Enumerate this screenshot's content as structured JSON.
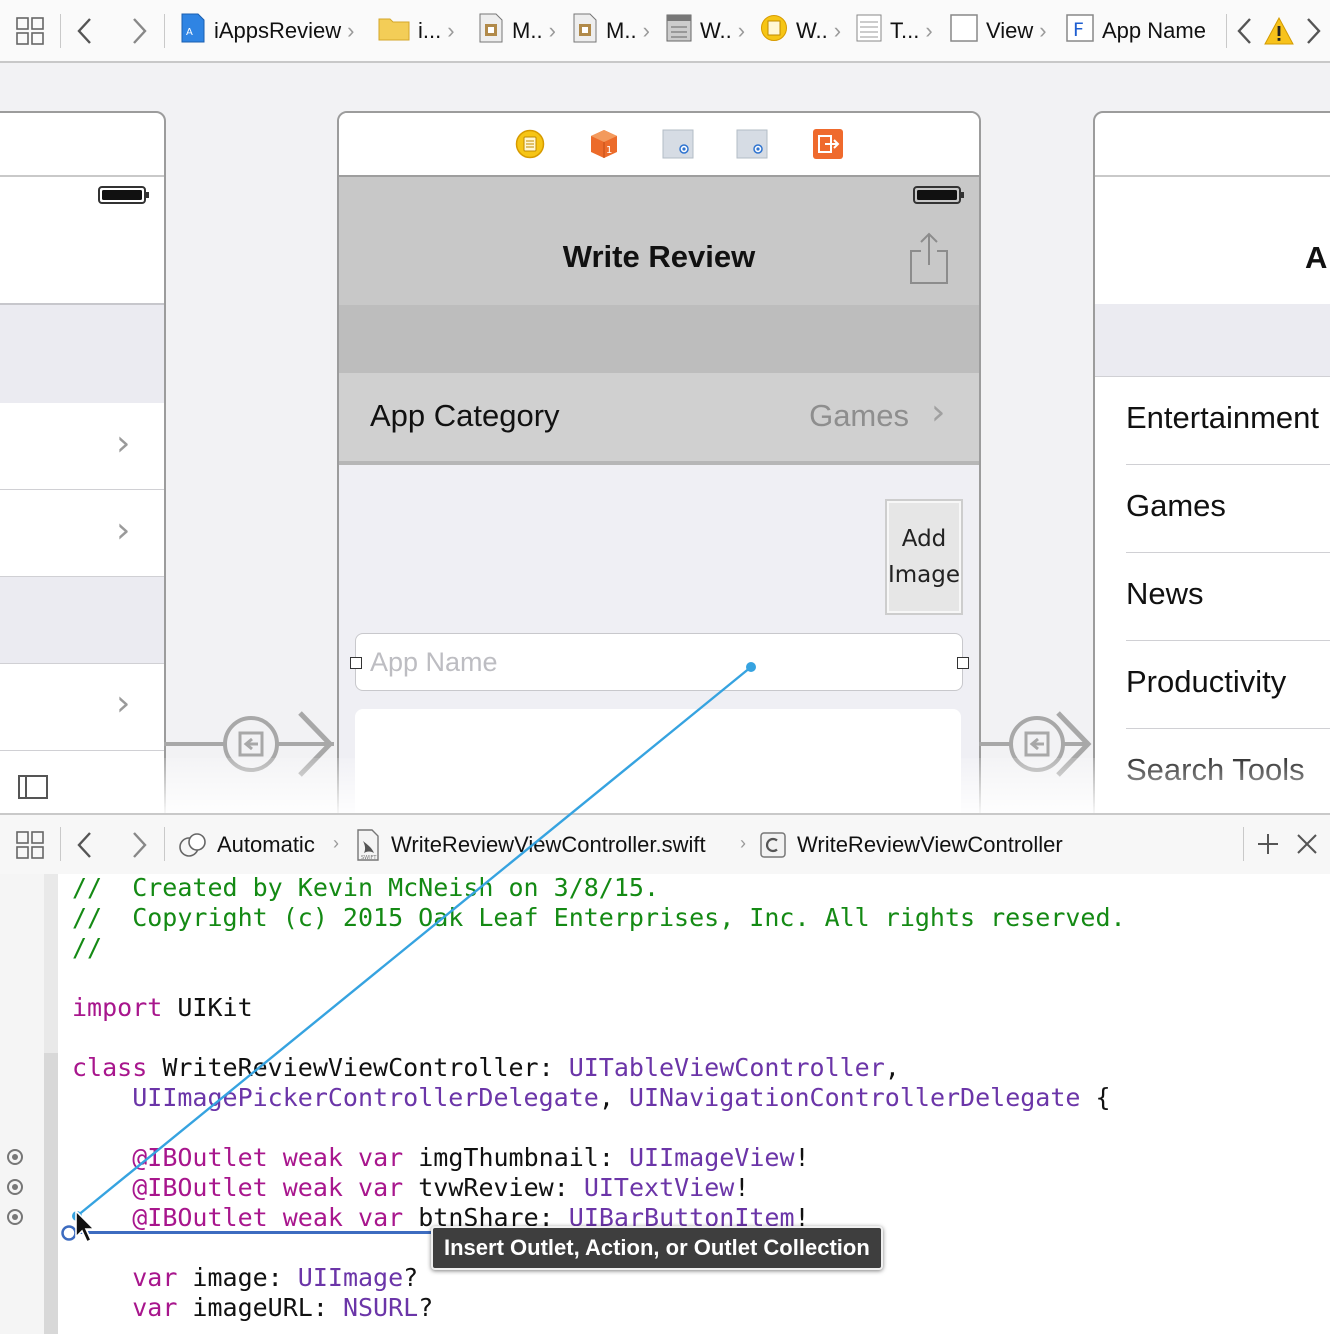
{
  "jump_bar": {
    "breadcrumbs": [
      {
        "label": "iAppsReview",
        "icon": "xcode-project-icon"
      },
      {
        "label": "i...",
        "icon": "folder-icon"
      },
      {
        "label": "M..",
        "icon": "storyboard-file-icon"
      },
      {
        "label": "M..",
        "icon": "storyboard-file-icon"
      },
      {
        "label": "W..",
        "icon": "scene-icon"
      },
      {
        "label": "W..",
        "icon": "view-controller-icon"
      },
      {
        "label": "T...",
        "icon": "table-view-icon"
      },
      {
        "label": "View",
        "icon": "view-icon"
      },
      {
        "label": "App Name",
        "icon": "text-field-icon",
        "icon_glyph": "F"
      }
    ]
  },
  "canvas": {
    "scene": {
      "nav_title": "Write Review",
      "category_label": "App Category",
      "category_value": "Games",
      "add_image_label_line1": "Add",
      "add_image_label_line2": "Image",
      "app_name_placeholder": "App Name"
    },
    "right_scene": {
      "nav_title_partial": "A",
      "categories": [
        "Entertainment",
        "Games",
        "News",
        "Productivity",
        "Search Tools"
      ]
    }
  },
  "assistant_bar": {
    "mode": "Automatic",
    "file": "WriteReviewViewController.swift",
    "class": "WriteReviewViewController"
  },
  "code": {
    "lines": [
      [
        {
          "t": "//  Created by Kevin McNeish on 3/8/15.",
          "c": "com"
        }
      ],
      [
        {
          "t": "//  Copyright (c) 2015 Oak Leaf Enterprises, Inc. All rights reserved.",
          "c": "com"
        }
      ],
      [
        {
          "t": "//",
          "c": "com"
        }
      ],
      [],
      [
        {
          "t": "import",
          "c": "kw"
        },
        {
          "t": " UIKit",
          "c": "pl"
        }
      ],
      [],
      [
        {
          "t": "class",
          "c": "kw"
        },
        {
          "t": " WriteReviewViewController: ",
          "c": "pl"
        },
        {
          "t": "UITableViewController",
          "c": "type"
        },
        {
          "t": ",",
          "c": "pl"
        }
      ],
      [
        {
          "t": "    ",
          "c": "pl"
        },
        {
          "t": "UIImagePickerControllerDelegate",
          "c": "type"
        },
        {
          "t": ", ",
          "c": "pl"
        },
        {
          "t": "UINavigationControllerDelegate",
          "c": "type"
        },
        {
          "t": " {",
          "c": "pl"
        }
      ],
      [],
      [
        {
          "t": "    ",
          "c": "pl"
        },
        {
          "t": "@IBOutlet",
          "c": "kw"
        },
        {
          "t": " ",
          "c": "pl"
        },
        {
          "t": "weak",
          "c": "kw"
        },
        {
          "t": " ",
          "c": "pl"
        },
        {
          "t": "var",
          "c": "kw"
        },
        {
          "t": " imgThumbnail: ",
          "c": "pl"
        },
        {
          "t": "UIImageView",
          "c": "type"
        },
        {
          "t": "!",
          "c": "pl"
        }
      ],
      [
        {
          "t": "    ",
          "c": "pl"
        },
        {
          "t": "@IBOutlet",
          "c": "kw"
        },
        {
          "t": " ",
          "c": "pl"
        },
        {
          "t": "weak",
          "c": "kw"
        },
        {
          "t": " ",
          "c": "pl"
        },
        {
          "t": "var",
          "c": "kw"
        },
        {
          "t": " tvwReview: ",
          "c": "pl"
        },
        {
          "t": "UITextView",
          "c": "type"
        },
        {
          "t": "!",
          "c": "pl"
        }
      ],
      [
        {
          "t": "    ",
          "c": "pl"
        },
        {
          "t": "@IBOutlet",
          "c": "kw"
        },
        {
          "t": " ",
          "c": "pl"
        },
        {
          "t": "weak",
          "c": "kw"
        },
        {
          "t": " ",
          "c": "pl"
        },
        {
          "t": "var",
          "c": "kw"
        },
        {
          "t": " btnShare: ",
          "c": "pl"
        },
        {
          "t": "UIBarButtonItem",
          "c": "type"
        },
        {
          "t": "!",
          "c": "pl"
        }
      ],
      [],
      [
        {
          "t": "    ",
          "c": "pl"
        },
        {
          "t": "var",
          "c": "kw"
        },
        {
          "t": " image: ",
          "c": "pl"
        },
        {
          "t": "UIImage",
          "c": "type"
        },
        {
          "t": "?",
          "c": "pl"
        }
      ],
      [
        {
          "t": "    ",
          "c": "pl"
        },
        {
          "t": "var",
          "c": "kw"
        },
        {
          "t": " imageURL: ",
          "c": "pl"
        },
        {
          "t": "NSURL",
          "c": "type"
        },
        {
          "t": "?",
          "c": "pl"
        }
      ]
    ]
  },
  "tooltip": "Insert Outlet, Action, or Outlet Collection",
  "colors": {
    "comment": "#148a14",
    "keyword": "#a8168d",
    "type": "#6b35a8",
    "connection_line": "#36a3e0"
  }
}
